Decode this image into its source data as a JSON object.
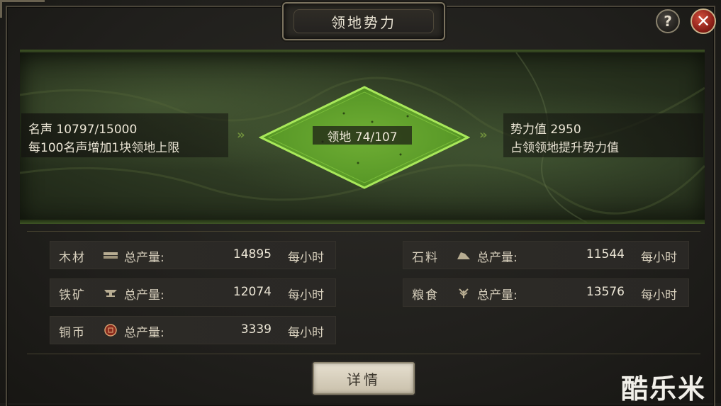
{
  "title": "领地势力",
  "help_icon": "?",
  "close_icon": "✕",
  "fame": {
    "line1": "名声 10797/15000",
    "line2": "每100名声增加1块领地上限"
  },
  "territory": {
    "label": "领地 74/107",
    "value": 74,
    "max": 107
  },
  "power": {
    "line1": "势力值 2950",
    "line2": "占领领地提升势力值"
  },
  "arrow_glyph": "»",
  "resources": [
    {
      "name": "木材",
      "icon": "wood-icon",
      "label": "总产量:",
      "value": "14895",
      "unit": "每小时"
    },
    {
      "name": "石料",
      "icon": "stone-icon",
      "label": "总产量:",
      "value": "11544",
      "unit": "每小时"
    },
    {
      "name": "铁矿",
      "icon": "iron-anvil-icon",
      "label": "总产量:",
      "value": "12074",
      "unit": "每小时"
    },
    {
      "name": "粮食",
      "icon": "grain-icon",
      "label": "总产量:",
      "value": "13576",
      "unit": "每小时"
    },
    {
      "name": "铜币",
      "icon": "copper-coin-icon",
      "label": "总产量:",
      "value": "3339",
      "unit": "每小时"
    }
  ],
  "detail_button": "详情",
  "watermark": "酷乐米",
  "colors": {
    "territory_green": "#7fc43a",
    "close_red": "#b8362a"
  }
}
